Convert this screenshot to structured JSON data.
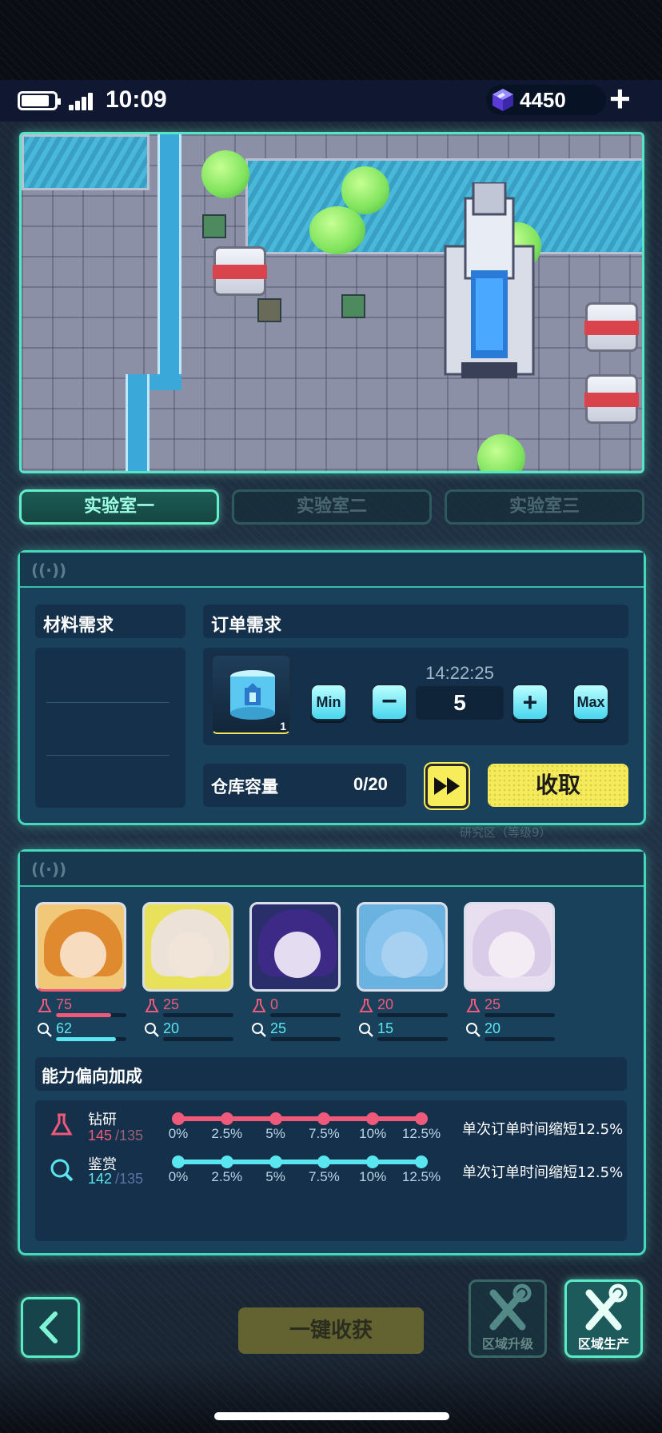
{
  "status": {
    "time": "10:09",
    "gems": "4450",
    "add_label": "+"
  },
  "lab_tabs": [
    {
      "label": "实验室一",
      "active": true
    },
    {
      "label": "实验室二",
      "active": false
    },
    {
      "label": "实验室三",
      "active": false
    }
  ],
  "order_panel": {
    "material_label": "材料需求",
    "order_label": "订单需求",
    "item_count": "1",
    "timer": "14:22:25",
    "quantity": "5",
    "min_label": "Min",
    "minus_label": "−",
    "plus_label": "+",
    "max_label": "Max",
    "storage_label": "仓库容量",
    "storage_value": "0/20",
    "fast_forward_label": "▶▶",
    "collect_label": "收取",
    "behind_text": "研究区（等级9）"
  },
  "team_panel": {
    "characters": [
      {
        "research": "75",
        "research_ratio": 0.78,
        "appraise": "62",
        "appraise_ratio": 0.85,
        "bg": "#f0c878",
        "hair": "#e08a30",
        "face": "#f7dcc0"
      },
      {
        "research": "25",
        "research_ratio": 0.0,
        "appraise": "20",
        "appraise_ratio": 0.0,
        "bg": "#e8e25a",
        "hair": "#ece2d8",
        "face": "#f1e4d8"
      },
      {
        "research": "0",
        "research_ratio": 0.0,
        "appraise": "25",
        "appraise_ratio": 0.0,
        "bg": "#2a2e6a",
        "hair": "#3c2a86",
        "face": "#e4dcf0"
      },
      {
        "research": "20",
        "research_ratio": 0.0,
        "appraise": "15",
        "appraise_ratio": 0.0,
        "bg": "#6ab2e0",
        "hair": "#88c4ee",
        "face": "#a8d0f0"
      },
      {
        "research": "25",
        "research_ratio": 0.0,
        "appraise": "20",
        "appraise_ratio": 0.0,
        "bg": "#e8e0f0",
        "hair": "#d8cce8",
        "face": "#f4ecf4"
      }
    ],
    "bonus_title": "能力偏向加成",
    "research": {
      "name": "钻研",
      "current": "145",
      "total": "/135",
      "bonus": "单次订单时间缩短12.5%",
      "color": "#f05a7a"
    },
    "appraise": {
      "name": "鉴赏",
      "current": "142",
      "total": "/135",
      "bonus": "单次订单时间缩短12.5%",
      "color": "#5ae6f0"
    },
    "ticks": [
      "0%",
      "2.5%",
      "5%",
      "7.5%",
      "10%",
      "12.5%"
    ]
  },
  "bottom": {
    "back_label": "‹",
    "harvest_label": "一键收获",
    "upgrade_label": "区域升级",
    "produce_label": "区域生产"
  },
  "colors": {
    "accent": "#45d8ba",
    "yellow": "#f4ea5a",
    "cyan_button": "#48d6ee",
    "pink": "#f05a7a",
    "cyan_stat": "#5ae6f0"
  }
}
